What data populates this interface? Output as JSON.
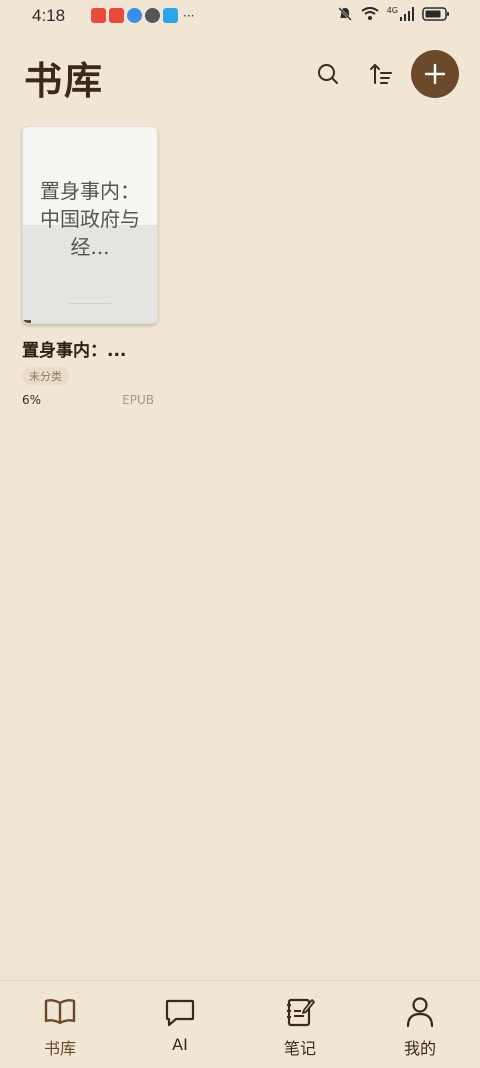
{
  "status_bar": {
    "time": "4:18",
    "notification_more": "···",
    "network": "4G"
  },
  "header": {
    "title": "书库"
  },
  "books": [
    {
      "cover_text": "置身事内：中国政府与经...",
      "title": "置身事内：...",
      "category": "未分类",
      "progress_text": "6%",
      "progress_value": 6,
      "format": "EPUB"
    }
  ],
  "bottom_nav": {
    "items": [
      {
        "label": "书库",
        "icon": "book-open-icon",
        "active": true
      },
      {
        "label": "AI",
        "icon": "chat-bubble-icon",
        "active": false
      },
      {
        "label": "笔记",
        "icon": "notebook-pen-icon",
        "active": false
      },
      {
        "label": "我的",
        "icon": "user-icon",
        "active": false
      }
    ]
  },
  "colors": {
    "background": "#F1E6D3",
    "accent": "#6B4A2B",
    "text": "#3B2A1A"
  }
}
